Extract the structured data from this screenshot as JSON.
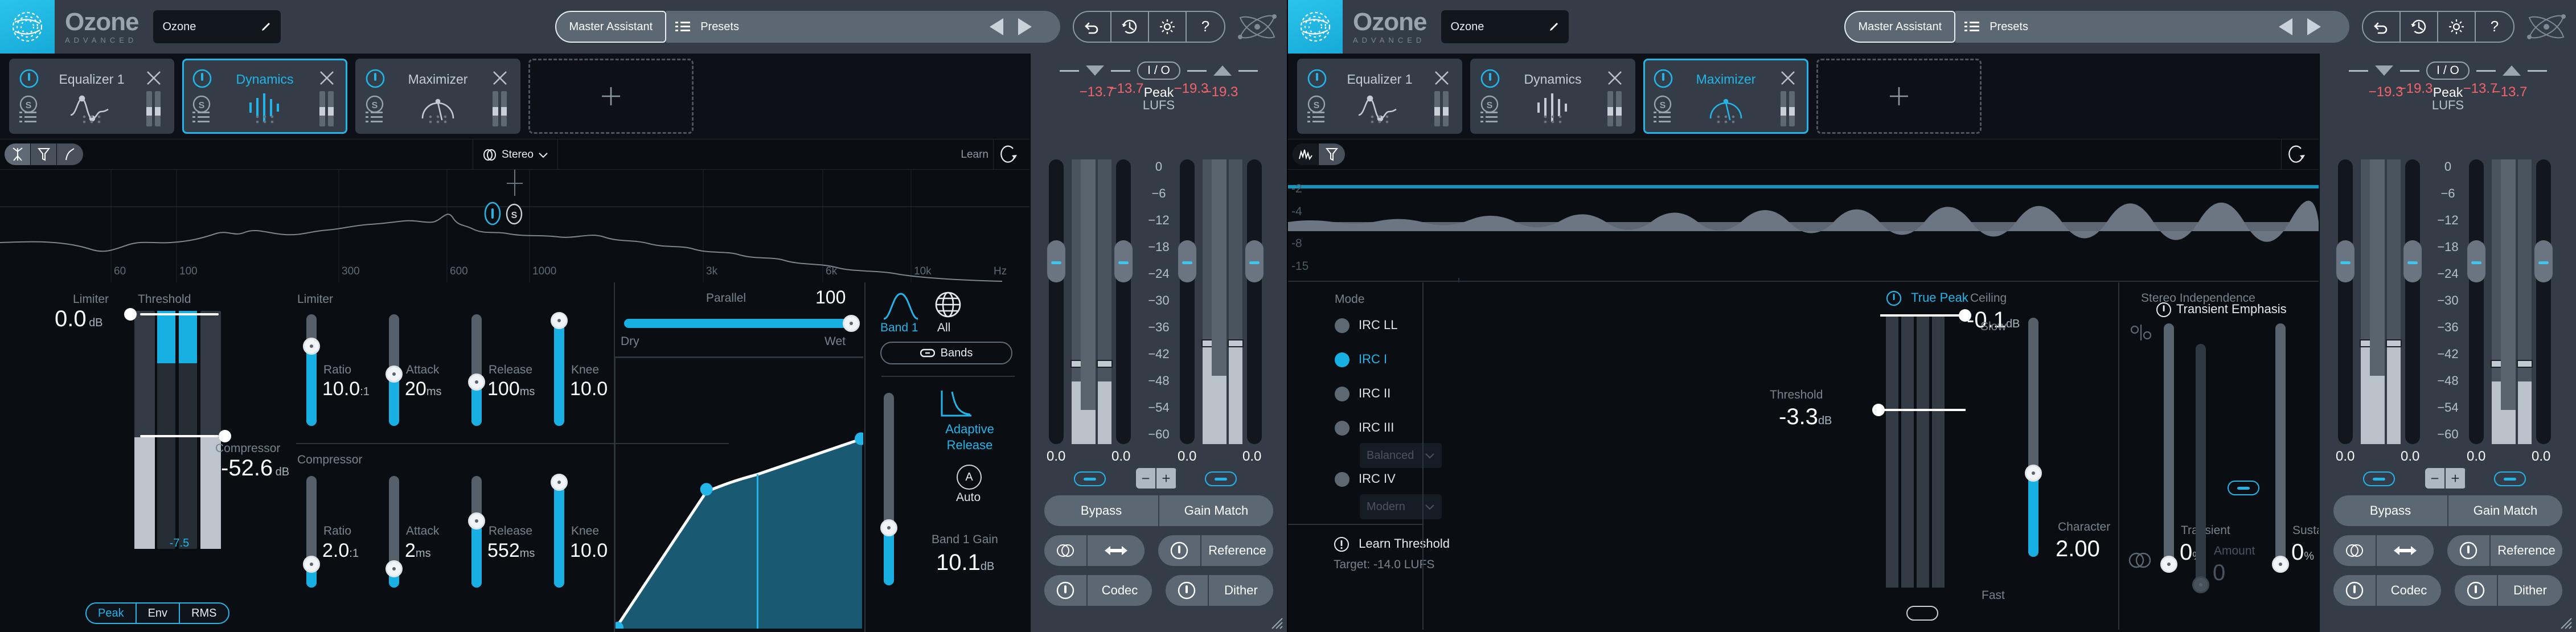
{
  "app": {
    "brand_name": "Ozone",
    "brand_sub": "ADVANCED",
    "preset_name": "Ozone",
    "master_assistant_label": "Master Assistant",
    "presets_label": "Presets"
  },
  "colors": {
    "accent": "#23b4e8",
    "meter_blue": "#18b0e2",
    "header_bg": "#343d47",
    "body_bg": "#0a0e13",
    "red_value": "#f4636b"
  },
  "modules": [
    {
      "name": "Equalizer 1",
      "active": false,
      "glyph": "eq-curve-icon"
    },
    {
      "name": "Dynamics",
      "active": true,
      "glyph": "dynamics-bars-icon"
    },
    {
      "name": "Maximizer",
      "active": false,
      "glyph": "maximizer-gauge-icon"
    }
  ],
  "modules_right": [
    {
      "name": "Equalizer 1",
      "active": false,
      "glyph": "eq-curve-icon"
    },
    {
      "name": "Dynamics",
      "active": false,
      "glyph": "dynamics-bars-icon"
    },
    {
      "name": "Maximizer",
      "active": true,
      "glyph": "maximizer-gauge-icon"
    }
  ],
  "left_pane": {
    "toolbar": {
      "stereo_label": "Stereo",
      "learn_label": "Learn",
      "modes": [
        "vectorscope-icon",
        "filter-icon",
        "curve-icon"
      ]
    },
    "spectrum": {
      "x_ticks": [
        "60",
        "100",
        "300",
        "600",
        "1000",
        "3k",
        "6k",
        "10k"
      ],
      "x_unit": "Hz",
      "band_marker_power": "I",
      "band_marker_solo": "S"
    },
    "dynamics": {
      "threshold_label": "Threshold",
      "limiter_label": "Limiter",
      "compressor_label": "Compressor",
      "limiter_threshold_value": "0.0",
      "limiter_threshold_unit": "dB",
      "compressor_threshold_value": "-52.6",
      "compressor_threshold_unit": "dB",
      "meter_readout": "-7.5",
      "detection_modes": [
        "Peak",
        "Env",
        "RMS"
      ],
      "detection_selected": "Peak",
      "limiter_params": [
        {
          "label": "Ratio",
          "value": "10.0",
          "unit": ":1",
          "fill": 0.72
        },
        {
          "label": "Attack",
          "value": "20",
          "unit": "ms",
          "fill": 0.5
        },
        {
          "label": "Release",
          "value": "100",
          "unit": "ms",
          "fill": 0.43
        },
        {
          "label": "Knee",
          "value": "10.0",
          "unit": "",
          "fill": 0.96
        }
      ],
      "compressor_params": [
        {
          "label": "Ratio",
          "value": "2.0",
          "unit": ":1",
          "fill": 0.24
        },
        {
          "label": "Attack",
          "value": "2",
          "unit": "ms",
          "fill": 0.2
        },
        {
          "label": "Release",
          "value": "552",
          "unit": "ms",
          "fill": 0.6
        },
        {
          "label": "Knee",
          "value": "10.0",
          "unit": "",
          "fill": 0.96
        }
      ],
      "parallel_label": "Parallel",
      "parallel_value": "100",
      "dry_label": "Dry",
      "wet_label": "Wet",
      "band_label": "Band 1",
      "all_label": "All",
      "bands_label": "Bands",
      "adaptive_release_label": "Adaptive Release",
      "auto_label": "Auto",
      "auto_letter": "A",
      "band_gain_label": "Band 1 Gain",
      "band_gain_value": "10.1",
      "band_gain_unit": "dB"
    },
    "io": {
      "peak_label": "Peak",
      "lufs_label": "LUFS",
      "in_l": "−13.7",
      "in_r": "−13.7",
      "out_l": "−19.3",
      "out_r": "−19.3",
      "scale": [
        "0",
        "−6",
        "−12",
        "−18",
        "−24",
        "−30",
        "−36",
        "−42",
        "−48",
        "−54",
        "−60"
      ],
      "gain_in_l": "0.0",
      "gain_in_r": "0.0",
      "gain_out_l": "0.0",
      "gain_out_r": "0.0",
      "io_label": "I / O",
      "bypass_label": "Bypass",
      "gain_match_label": "Gain Match",
      "reference_label": "Reference",
      "codec_label": "Codec",
      "dither_label": "Dither",
      "minus_label": "−",
      "plus_label": "+"
    }
  },
  "right_pane": {
    "toolbar": {
      "modes": [
        "spectrum-icon",
        "filter-icon"
      ]
    },
    "waveform": {
      "y_ticks": [
        "-2",
        "-4",
        "-8",
        "-15"
      ]
    },
    "maximizer": {
      "mode_label": "Mode",
      "modes": [
        {
          "name": "IRC LL",
          "selected": false
        },
        {
          "name": "IRC I",
          "selected": true
        },
        {
          "name": "IRC II",
          "selected": false
        },
        {
          "name": "IRC III",
          "selected": false,
          "dropdown": "Balanced"
        },
        {
          "name": "IRC IV",
          "selected": false,
          "dropdown": "Modern"
        }
      ],
      "learn_threshold_label": "Learn Threshold",
      "target_label": "Target: -14.0 LUFS",
      "true_peak_label": "True Peak",
      "threshold_label": "Threshold",
      "threshold_value": "-3.3",
      "threshold_unit": "dB",
      "ceiling_label": "Ceiling",
      "ceiling_value": "-0.1",
      "ceiling_unit": "dB",
      "slow_label": "Slow",
      "fast_label": "Fast",
      "character_label": "Character",
      "character_value": "2.00",
      "stereo_independence_label": "Stereo Independence",
      "transient_label": "Transient",
      "transient_value": "0",
      "transient_unit": "%",
      "sustain_label": "Sustain",
      "sustain_value": "0",
      "sustain_unit": "%",
      "transient_emphasis_label": "Transient Emphasis",
      "amount_label": "Amount",
      "amount_value": "0"
    },
    "io": {
      "peak_label": "Peak",
      "lufs_label": "LUFS",
      "in_l": "−19.3",
      "in_r": "−19.3",
      "out_l": "−13.7",
      "out_r": "−13.7",
      "scale": [
        "0",
        "−6",
        "−12",
        "−18",
        "−24",
        "−30",
        "−36",
        "−42",
        "−48",
        "−54",
        "−60"
      ],
      "gain_in_l": "0.0",
      "gain_in_r": "0.0",
      "gain_out_l": "0.0",
      "gain_out_r": "0.0",
      "io_label": "I / O",
      "bypass_label": "Bypass",
      "gain_match_label": "Gain Match",
      "reference_label": "Reference",
      "codec_label": "Codec",
      "dither_label": "Dither",
      "minus_label": "−",
      "plus_label": "+"
    }
  }
}
